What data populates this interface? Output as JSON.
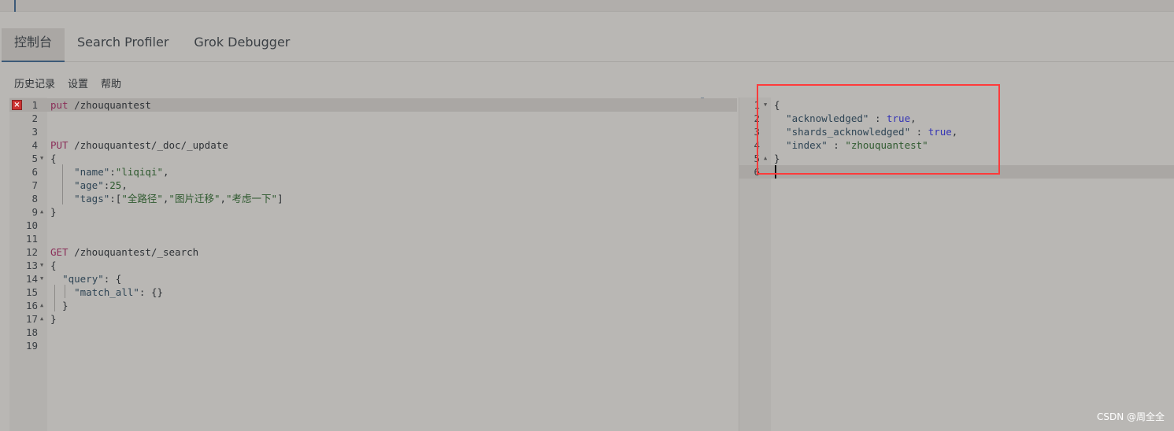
{
  "tabs": [
    {
      "label": "控制台",
      "active": true
    },
    {
      "label": "Search Profiler"
    },
    {
      "label": "Grok Debugger"
    }
  ],
  "toolbar": {
    "history": "历史记录",
    "settings": "设置",
    "help": "帮助"
  },
  "editor": {
    "lines": [
      [
        [
          "m",
          "put"
        ],
        [
          "t",
          " /zhouquantest"
        ]
      ],
      [],
      [],
      [
        [
          "m",
          "PUT"
        ],
        [
          "t",
          " /zhouquantest/_doc/_update"
        ]
      ],
      [
        [
          "t",
          "{"
        ]
      ],
      [
        [
          "t",
          "    "
        ],
        [
          "k",
          "\"name\""
        ],
        [
          "t",
          ":"
        ],
        [
          "s",
          "\"liqiqi\""
        ],
        [
          "t",
          ","
        ]
      ],
      [
        [
          "t",
          "    "
        ],
        [
          "k",
          "\"age\""
        ],
        [
          "t",
          ":"
        ],
        [
          "s",
          "25"
        ],
        [
          "t",
          ","
        ]
      ],
      [
        [
          "t",
          "    "
        ],
        [
          "k",
          "\"tags\""
        ],
        [
          "t",
          ":["
        ],
        [
          "s",
          "\"全路径\""
        ],
        [
          "t",
          ","
        ],
        [
          "s",
          "\"图片迁移\""
        ],
        [
          "t",
          ","
        ],
        [
          "s",
          "\"考虑一下\""
        ],
        [
          "t",
          "]"
        ]
      ],
      [
        [
          "t",
          "}"
        ]
      ],
      [],
      [],
      [
        [
          "m",
          "GET"
        ],
        [
          "t",
          " /zhouquantest/_search"
        ]
      ],
      [
        [
          "t",
          "{"
        ]
      ],
      [
        [
          "t",
          "  "
        ],
        [
          "k",
          "\"query\""
        ],
        [
          "t",
          ": {"
        ]
      ],
      [
        [
          "t",
          "    "
        ],
        [
          "k",
          "\"match_all\""
        ],
        [
          "t",
          ": {}"
        ]
      ],
      [
        [
          "t",
          "  }"
        ]
      ],
      [
        [
          "t",
          "}"
        ]
      ],
      [],
      []
    ],
    "folds": {
      "5": "down",
      "9": "up",
      "13": "down",
      "14": "down",
      "16": "up",
      "17": "up"
    },
    "error_line": 1,
    "error_icon": "error-x-icon"
  },
  "output": {
    "lines": [
      [
        [
          "t",
          "{"
        ]
      ],
      [
        [
          "t",
          "  "
        ],
        [
          "k",
          "\"acknowledged\""
        ],
        [
          "t",
          " : "
        ],
        [
          "b",
          "true"
        ],
        [
          "t",
          ","
        ]
      ],
      [
        [
          "t",
          "  "
        ],
        [
          "k",
          "\"shards_acknowledged\""
        ],
        [
          "t",
          " : "
        ],
        [
          "b",
          "true"
        ],
        [
          "t",
          ","
        ]
      ],
      [
        [
          "t",
          "  "
        ],
        [
          "k",
          "\"index\""
        ],
        [
          "t",
          " : "
        ],
        [
          "s",
          "\"zhouquantest\""
        ]
      ],
      [
        [
          "t",
          "}"
        ]
      ],
      []
    ],
    "folds": {
      "1": "down",
      "5": "up"
    }
  },
  "actions": {
    "run_icon": "play-icon",
    "settings_icon": "wrench-icon"
  },
  "watermark": "CSDN @周全全",
  "colors": {
    "accent": "#3d5a78",
    "highlight_box": "#ff3b3b"
  }
}
